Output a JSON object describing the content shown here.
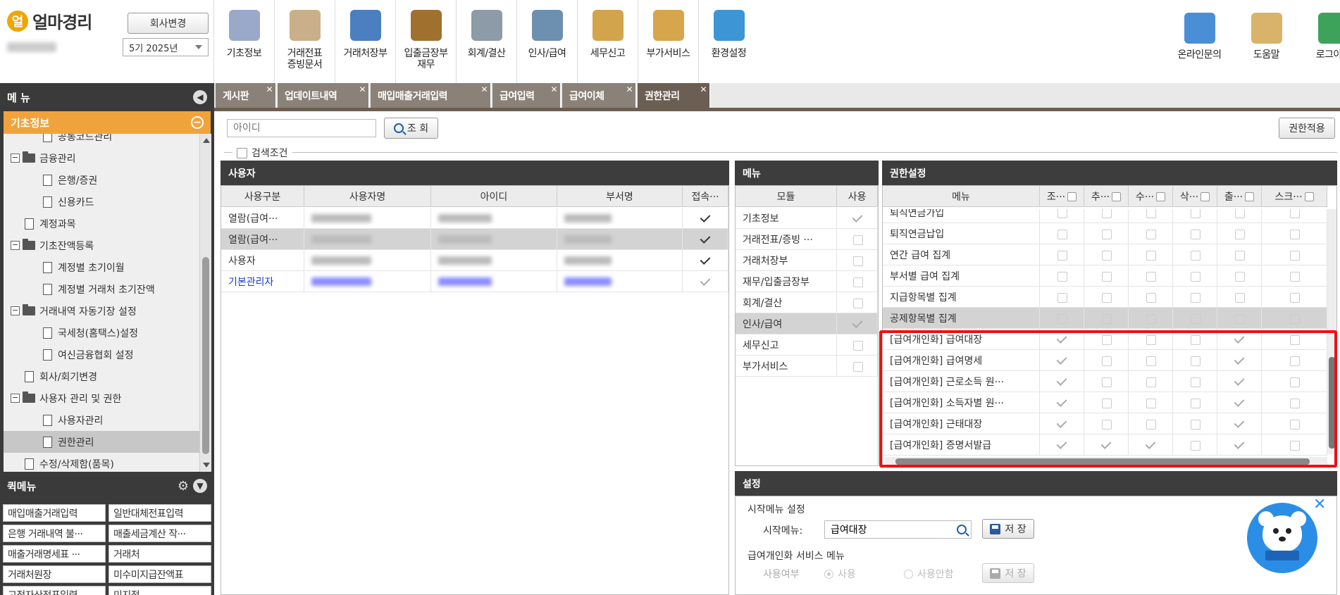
{
  "app": {
    "logo_mark": "얼",
    "logo_text": "얼마경리",
    "company_change_label": "회사변경",
    "period_value": "5기 2025년"
  },
  "toolbar": {
    "items": [
      {
        "label": "기초정보",
        "icon": "basic-info-icon"
      },
      {
        "label": "거래전표\n증빙문서",
        "icon": "voucher-icon"
      },
      {
        "label": "거래처장부",
        "icon": "ledger-icon"
      },
      {
        "label": "입출금장부\n재무",
        "icon": "money-bag-icon"
      },
      {
        "label": "회계/결산",
        "icon": "clipboard-icon"
      },
      {
        "label": "인사/급여",
        "icon": "hr-icon"
      },
      {
        "label": "세무신고",
        "icon": "tax-icon"
      },
      {
        "label": "부가서비스",
        "icon": "bank-icon"
      },
      {
        "label": "환경설정",
        "icon": "gear-icon"
      }
    ],
    "right_items": [
      {
        "label": "온라인문의",
        "icon": "support-agent-icon"
      },
      {
        "label": "도움말",
        "icon": "help-book-icon"
      },
      {
        "label": "로그아웃",
        "icon": "logout-icon"
      }
    ]
  },
  "sidebar": {
    "menu_title": "메 뉴",
    "section_title": "기초정보",
    "tree": [
      {
        "label": "공통코드관리",
        "type": "doc",
        "level": 2
      },
      {
        "label": "금융관리",
        "type": "folder",
        "level": 0
      },
      {
        "label": "은행/증권",
        "type": "doc",
        "level": 2
      },
      {
        "label": "신용카드",
        "type": "doc",
        "level": 2
      },
      {
        "label": "계정과목",
        "type": "doc",
        "level": 1
      },
      {
        "label": "기초잔액등록",
        "type": "folder",
        "level": 0
      },
      {
        "label": "계정별 초기이월",
        "type": "doc",
        "level": 2
      },
      {
        "label": "계정별 거래처 초기잔액",
        "type": "doc",
        "level": 2
      },
      {
        "label": "거래내역 자동기장 설정",
        "type": "folder",
        "level": 0
      },
      {
        "label": "국세청(홈택스)설정",
        "type": "doc",
        "level": 2
      },
      {
        "label": "여신금융협회 설정",
        "type": "doc",
        "level": 2
      },
      {
        "label": "회사/회기변경",
        "type": "doc",
        "level": 1
      },
      {
        "label": "사용자 관리 및 권한",
        "type": "folder",
        "level": 0
      },
      {
        "label": "사용자관리",
        "type": "doc",
        "level": 2
      },
      {
        "label": "권한관리",
        "type": "doc",
        "level": 2,
        "selected": true
      },
      {
        "label": "수정/삭제함(품목)",
        "type": "doc",
        "level": 1
      }
    ],
    "quick_title": "퀵메뉴",
    "quick_items": [
      "매입매출거래입력",
      "일반대체전표입력",
      "은행 거래내역 불···",
      "매출세금계산 작···",
      "매출거래명세표 ···",
      "거래처",
      "거래처원장",
      "미수미지급잔액표",
      "고정자산전표입력",
      "미지점"
    ]
  },
  "tabs": [
    {
      "label": "게시판"
    },
    {
      "label": "업데이트내역"
    },
    {
      "label": "매입매출거래입력"
    },
    {
      "label": "급여입력"
    },
    {
      "label": "급여이체"
    },
    {
      "label": "권한관리",
      "active": true
    }
  ],
  "search": {
    "placeholder": "아이디",
    "button_label": "조 회",
    "condition_label": "검색조건",
    "apply_label": "권한적용"
  },
  "users": {
    "title": "사용자",
    "columns": [
      "사용구분",
      "사용자명",
      "아이디",
      "부서명",
      "접속···"
    ],
    "rows": [
      {
        "type": "열람(급여···",
        "access": "on"
      },
      {
        "type": "열람(급여···",
        "access": "on",
        "selected": true
      },
      {
        "type": "사용자",
        "access": "on"
      },
      {
        "type": "기본관리자",
        "access": "dim",
        "blue": true
      }
    ]
  },
  "menu_panel": {
    "title": "메뉴",
    "columns": [
      "모듈",
      "사용"
    ],
    "rows": [
      {
        "module": "기초정보",
        "use": "dim"
      },
      {
        "module": "거래전표/증빙 ···",
        "use": "off"
      },
      {
        "module": "거래처장부",
        "use": "off"
      },
      {
        "module": "재무/입출금장부",
        "use": "off"
      },
      {
        "module": "회계/결산",
        "use": "off"
      },
      {
        "module": "인사/급여",
        "use": "dim",
        "selected": true
      },
      {
        "module": "세무신고",
        "use": "off"
      },
      {
        "module": "부가서비스",
        "use": "off"
      }
    ]
  },
  "permissions": {
    "title": "권한설정",
    "columns": [
      "메뉴",
      "조···",
      "추···",
      "수···",
      "삭···",
      "출···",
      "스크···"
    ],
    "rows": [
      {
        "menu": "퇴직연금가입",
        "p": [
          "off",
          "off",
          "off",
          "off",
          "off",
          "off"
        ]
      },
      {
        "menu": "퇴직연금납입",
        "p": [
          "off",
          "off",
          "off",
          "off",
          "off",
          "off"
        ]
      },
      {
        "menu": "연간 급여 집계",
        "p": [
          "off",
          "off",
          "off",
          "off",
          "off",
          "off"
        ]
      },
      {
        "menu": "부서별 급여 집계",
        "p": [
          "off",
          "off",
          "off",
          "off",
          "off",
          "off"
        ]
      },
      {
        "menu": "지급항목별 집계",
        "p": [
          "off",
          "off",
          "off",
          "off",
          "off",
          "off"
        ]
      },
      {
        "menu": "공제항목별 집계",
        "p": [
          "off",
          "off",
          "off",
          "off",
          "off",
          "off"
        ],
        "selected": true
      },
      {
        "menu": "[급여개인화] 급여대장",
        "p": [
          "dim",
          "off",
          "off",
          "off",
          "dim",
          "off"
        ]
      },
      {
        "menu": "[급여개인화] 급여명세",
        "p": [
          "dim",
          "off",
          "off",
          "off",
          "dim",
          "off"
        ]
      },
      {
        "menu": "[급여개인화] 근로소득 원···",
        "p": [
          "dim",
          "off",
          "off",
          "off",
          "dim",
          "off"
        ]
      },
      {
        "menu": "[급여개인화] 소득자별 원···",
        "p": [
          "dim",
          "off",
          "off",
          "off",
          "dim",
          "off"
        ]
      },
      {
        "menu": "[급여개인화] 근태대장",
        "p": [
          "dim",
          "off",
          "off",
          "off",
          "dim",
          "off"
        ]
      },
      {
        "menu": "[급여개인화] 증명서발급",
        "p": [
          "dim",
          "dim",
          "dim",
          "off",
          "dim",
          "off"
        ]
      }
    ]
  },
  "settings": {
    "title": "설정",
    "start_menu_section": "시작메뉴 설정",
    "start_menu_label": "시작메뉴:",
    "start_menu_value": "급여대장",
    "save_label": "저 장",
    "personal_section": "급여개인화 서비스 메뉴",
    "use_label": "사용여부",
    "use_yes": "사용",
    "use_no": "사용안함"
  },
  "colors": {
    "accent_orange": "#f1a33b",
    "tab_brown": "#8a8178",
    "highlight_red": "#e11111",
    "dark_panel": "#3d3d3d"
  }
}
